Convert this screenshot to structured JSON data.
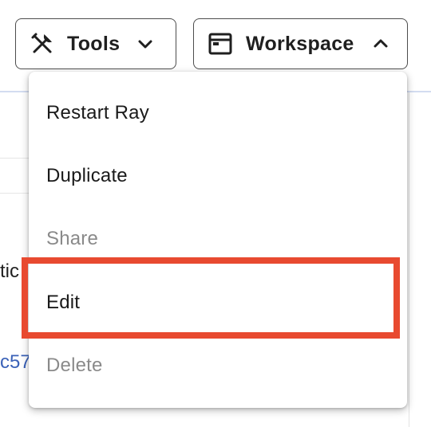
{
  "toolbar": {
    "tools": {
      "label": "Tools",
      "icon": "tools-icon",
      "chevron": "chevron-down-icon"
    },
    "workspace": {
      "label": "Workspace",
      "icon": "browser-window-icon",
      "chevron": "chevron-up-icon",
      "expanded": true
    }
  },
  "menu": {
    "items": [
      {
        "label": "Restart Ray",
        "enabled": true
      },
      {
        "label": "Duplicate",
        "enabled": true
      },
      {
        "label": "Share",
        "enabled": false
      },
      {
        "label": "Edit",
        "enabled": true,
        "highlighted": true
      },
      {
        "label": "Delete",
        "enabled": false
      }
    ]
  },
  "background": {
    "partial_text_1": "tic",
    "partial_link_1": "c57"
  },
  "colors": {
    "highlight_border": "#e84a30",
    "disabled_text": "#8a8a8a",
    "link": "#3b62b8",
    "divider_accent": "#d3dcf0"
  }
}
